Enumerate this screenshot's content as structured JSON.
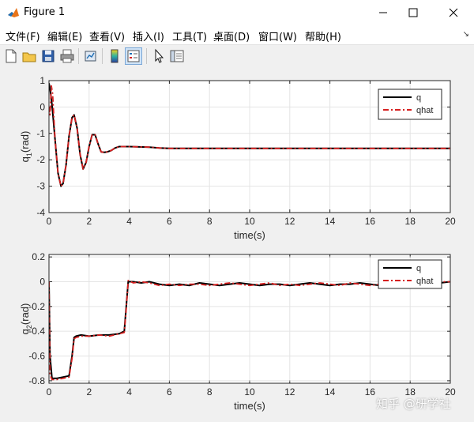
{
  "window": {
    "title": "Figure 1"
  },
  "menu": [
    "文件(F)",
    "编辑(E)",
    "查看(V)",
    "插入(I)",
    "工具(T)",
    "桌面(D)",
    "窗口(W)",
    "帮助(H)"
  ],
  "menu_overflow_icon": "menu-overflow-arrow-icon",
  "toolbar": [
    "new-figure-icon",
    "open-icon",
    "save-icon",
    "print-icon",
    "link-plot-icon",
    "colorbar-icon",
    "legend-icon",
    "pointer-icon",
    "property-editor-icon"
  ],
  "colors": {
    "q": "#000000",
    "qhat": "#d62020",
    "axes_bg": "#ffffff",
    "figure_bg": "#f0f0f0"
  },
  "watermark": "知乎 @研学社",
  "chart_data": [
    {
      "type": "line",
      "xlabel": "time(s)",
      "ylabel": "q1(rad)",
      "ylabel_main": "q",
      "ylabel_sub": "1",
      "ylabel_unit": "(rad)",
      "xlim": [
        0,
        20
      ],
      "ylim": [
        -4,
        1
      ],
      "xticks": [
        "0",
        "2",
        "4",
        "6",
        "8",
        "10",
        "12",
        "14",
        "16",
        "18",
        "20"
      ],
      "yticks": [
        "1",
        "0",
        "-1",
        "-2",
        "-3",
        "-4"
      ],
      "grid": true,
      "legend_position": "top-right",
      "legend": [
        "q",
        "qhat"
      ],
      "series": [
        {
          "name": "q",
          "color": "#000000",
          "style": "solid",
          "x": [
            0,
            0.05,
            0.15,
            0.3,
            0.45,
            0.6,
            0.7,
            0.85,
            1.0,
            1.15,
            1.25,
            1.4,
            1.55,
            1.7,
            1.85,
            2.0,
            2.15,
            2.3,
            2.45,
            2.6,
            2.75,
            2.9,
            3.1,
            3.3,
            3.5,
            4.0,
            5.0,
            5.5,
            6,
            8,
            10,
            12,
            14,
            16,
            18,
            20
          ],
          "y": [
            0.9,
            0.7,
            0.1,
            -1.2,
            -2.5,
            -3.0,
            -2.9,
            -2.2,
            -1.1,
            -0.4,
            -0.3,
            -0.8,
            -1.8,
            -2.35,
            -2.1,
            -1.5,
            -1.05,
            -1.05,
            -1.4,
            -1.7,
            -1.72,
            -1.7,
            -1.65,
            -1.55,
            -1.5,
            -1.5,
            -1.52,
            -1.55,
            -1.57,
            -1.57,
            -1.57,
            -1.57,
            -1.57,
            -1.57,
            -1.57,
            -1.57
          ]
        },
        {
          "name": "qhat",
          "color": "#d62020",
          "style": "dashdot",
          "x": [
            0,
            0.05,
            0.12,
            0.18,
            0.3,
            0.45,
            0.6,
            0.7,
            0.85,
            1.0,
            1.15,
            1.25,
            1.4,
            1.55,
            1.7,
            1.85,
            2.0,
            2.15,
            2.3,
            2.45,
            2.6,
            2.75,
            2.9,
            3.1,
            3.3,
            3.5,
            4.0,
            5.0,
            5.5,
            6,
            8,
            10,
            12,
            14,
            16,
            18,
            20
          ],
          "y": [
            0,
            -0.3,
            0.8,
            0.5,
            -1.2,
            -2.5,
            -3.0,
            -2.9,
            -2.2,
            -1.1,
            -0.4,
            -0.3,
            -0.8,
            -1.8,
            -2.35,
            -2.1,
            -1.5,
            -1.05,
            -1.05,
            -1.4,
            -1.7,
            -1.72,
            -1.7,
            -1.65,
            -1.55,
            -1.5,
            -1.5,
            -1.52,
            -1.55,
            -1.57,
            -1.57,
            -1.57,
            -1.57,
            -1.57,
            -1.57,
            -1.57,
            -1.57
          ]
        }
      ]
    },
    {
      "type": "line",
      "xlabel": "time(s)",
      "ylabel": "q2(rad)",
      "ylabel_main": "q",
      "ylabel_sub": "2",
      "ylabel_unit": "(rad)",
      "xlim": [
        0,
        20
      ],
      "ylim": [
        -0.82,
        0.22
      ],
      "xticks": [
        "0",
        "2",
        "4",
        "6",
        "8",
        "10",
        "12",
        "14",
        "16",
        "18",
        "20"
      ],
      "yticks": [
        "0.2",
        "0",
        "-0.2",
        "-0.4",
        "-0.6",
        "-0.8"
      ],
      "ytick_values": [
        0.2,
        0,
        -0.2,
        -0.4,
        -0.6,
        -0.8
      ],
      "grid": true,
      "legend_position": "top-right",
      "legend": [
        "q",
        "qhat"
      ],
      "series": [
        {
          "name": "q",
          "color": "#000000",
          "style": "solid",
          "x": [
            0,
            0.05,
            0.15,
            0.4,
            0.7,
            1.0,
            1.15,
            1.25,
            1.35,
            1.6,
            2.0,
            2.5,
            3.0,
            3.5,
            3.75,
            3.85,
            3.95,
            4.2,
            4.6,
            5.0,
            5.5,
            6,
            6.5,
            7,
            7.5,
            8,
            8.5,
            9,
            9.5,
            10,
            10.5,
            11,
            11.5,
            12,
            12.5,
            13,
            13.5,
            14,
            14.5,
            15,
            15.5,
            16,
            16.5,
            17,
            17.5,
            18,
            18.5,
            19,
            19.5,
            20
          ],
          "y": [
            0,
            -0.6,
            -0.78,
            -0.78,
            -0.77,
            -0.76,
            -0.6,
            -0.45,
            -0.44,
            -0.43,
            -0.44,
            -0.43,
            -0.43,
            -0.42,
            -0.4,
            -0.2,
            0.0,
            0.0,
            -0.01,
            0.0,
            -0.02,
            -0.03,
            -0.02,
            -0.03,
            -0.01,
            -0.02,
            -0.03,
            -0.02,
            -0.01,
            -0.02,
            -0.03,
            -0.02,
            -0.02,
            -0.03,
            -0.02,
            -0.01,
            -0.02,
            -0.03,
            -0.02,
            -0.02,
            -0.01,
            -0.02,
            -0.03,
            -0.02,
            -0.01,
            -0.01,
            -0.02,
            -0.01,
            -0.01,
            0.0
          ]
        },
        {
          "name": "qhat",
          "color": "#d62020",
          "style": "dashdot",
          "x": [
            0,
            0.05,
            0.15,
            0.4,
            0.7,
            1.0,
            1.15,
            1.25,
            1.35,
            1.6,
            2.0,
            2.5,
            3.0,
            3.5,
            3.75,
            3.85,
            3.95,
            4.2,
            4.6,
            5.0,
            5.5,
            6,
            6.5,
            7,
            7.5,
            8,
            8.5,
            9,
            9.5,
            10,
            10.5,
            11,
            11.5,
            12,
            12.5,
            13,
            13.5,
            14,
            14.5,
            15,
            15.5,
            16,
            16.5,
            17,
            17.5,
            18,
            18.5,
            19,
            19.5,
            20
          ],
          "y": [
            0,
            -0.75,
            -0.79,
            -0.79,
            -0.78,
            -0.77,
            -0.62,
            -0.46,
            -0.45,
            -0.44,
            -0.44,
            -0.43,
            -0.44,
            -0.42,
            -0.41,
            -0.22,
            0.01,
            -0.01,
            0.0,
            -0.01,
            -0.03,
            -0.02,
            -0.03,
            -0.02,
            -0.02,
            -0.03,
            -0.02,
            -0.01,
            -0.02,
            -0.03,
            -0.02,
            -0.01,
            -0.03,
            -0.02,
            -0.03,
            -0.02,
            -0.01,
            -0.02,
            -0.03,
            -0.01,
            -0.02,
            -0.03,
            -0.02,
            -0.01,
            -0.02,
            -0.01,
            -0.02,
            -0.01,
            0.0,
            0.0
          ]
        }
      ]
    }
  ]
}
